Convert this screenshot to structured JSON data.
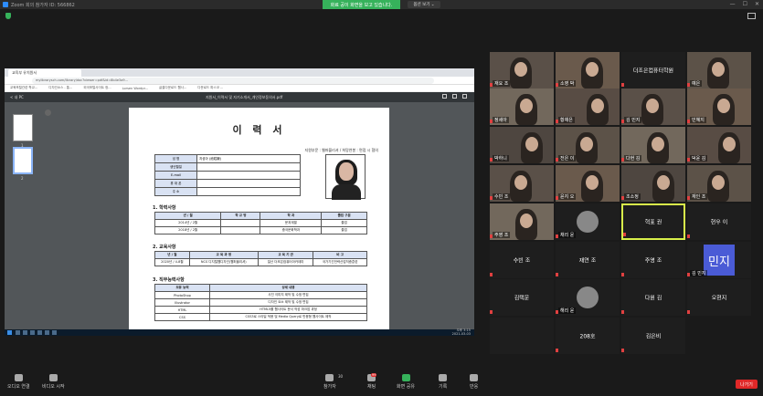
{
  "window": {
    "title": "Zoom 회의 참가자 ID: 566862",
    "share_banner": "화료 공이 화면을 보고 있습니다.",
    "view_options": "옵션 보기 ⌄",
    "controls": [
      "—",
      "☐",
      "✕"
    ]
  },
  "browser": {
    "tab_title": "교육부 유치원서",
    "url": "mylibrarysch.com/library/doc?viewer=pdf&id=8b4e3a9...",
    "bookmarks": [
      "교육포털관련 학교...",
      "디자인소스 - 통...",
      "외국포털사이트 정...",
      "Lorsen Wordpr...",
      "글꼴다운로드 웹사...",
      "다운로드 파스코 ..."
    ]
  },
  "pdf": {
    "back": "< 내 PC",
    "filename": "지원서_이력서 및 자기소개서_개인정보동의서.pdf",
    "thumb_nums": [
      "1",
      "2"
    ],
    "doc_title": "이 력 서",
    "apply_line": "지원부문 : 웹퍼블리셔  /  희망연봉 : 면접 시 협의",
    "info_rows": [
      {
        "k": "성 명",
        "v": "지성아 (池姓娥)"
      },
      {
        "k": "생년월일",
        "v": ""
      },
      {
        "k": "E-mail",
        "v": ""
      },
      {
        "k": "휴 대 폰",
        "v": ""
      },
      {
        "k": "주 소",
        "v": ""
      }
    ],
    "sec1": "1. 학력사항",
    "sec1_head": [
      "년 / 월",
      "학 교 명",
      "학 과",
      "졸업 구분"
    ],
    "sec1_rows": [
      [
        "2014년 / 2월",
        "",
        "문과계열",
        "졸업"
      ],
      [
        "2018년 / 2월",
        "",
        "중국문화학과",
        "졸업"
      ]
    ],
    "sec2": "2. 교육사항",
    "sec2_head": [
      "년 / 월",
      "교 육 과 정",
      "교 육 기 관",
      "비 고"
    ],
    "sec2_rows": [
      [
        "2020년 / 4-8월",
        "NCS 디지털웹디자인(웹퍼블리셔)",
        "일산 더조은컴퓨터아카데미",
        "국가기간전략산업직종훈련"
      ]
    ],
    "sec3": "3. 직무능력사항",
    "sec3_head": [
      "보유 능력",
      "상세 내용"
    ],
    "sec3_rows": [
      [
        "PhotoShop",
        "사진 이미지 제작 및 수정 편집"
      ],
      [
        "Illustrator",
        "디자인 요소 제작 및 수정 편집"
      ],
      [
        "HTML",
        "HTML5를 웹사이트 문서 작성 마크업 과정"
      ],
      [
        "CSS",
        "CSS3로 스타일 적용 및 Media Query로 반응형 웹사이트 제작"
      ]
    ],
    "clock": [
      "오후 3:15",
      "2021-03-03"
    ]
  },
  "gallery": [
    {
      "caption": "재요 조",
      "type": "video"
    },
    {
      "caption": "소영 박",
      "type": "video"
    },
    {
      "caption": "더조은컴퓨터학원",
      "type": "name"
    },
    {
      "caption": "예은",
      "type": "video"
    },
    {
      "caption": "정세아",
      "type": "video"
    },
    {
      "caption": "황채은",
      "type": "video"
    },
    {
      "caption": "김 민지",
      "type": "video"
    },
    {
      "caption": "민혜지",
      "type": "video"
    },
    {
      "caption": "박하니",
      "type": "video"
    },
    {
      "caption": "전은 이",
      "type": "video"
    },
    {
      "caption": "다현 김",
      "type": "video"
    },
    {
      "caption": "덕윤 김",
      "type": "video"
    },
    {
      "caption": "수빈 조",
      "type": "video"
    },
    {
      "caption": "윤지 오",
      "type": "video"
    },
    {
      "caption": "조소정",
      "type": "video"
    },
    {
      "caption": "재인 조",
      "type": "video"
    },
    {
      "caption": "주영 조",
      "type": "video"
    },
    {
      "caption": "채리 윤",
      "type": "avatar"
    },
    {
      "caption": "혁표 권",
      "type": "active"
    },
    {
      "caption": "현우 이",
      "type": "name"
    },
    {
      "caption": "수빈 조",
      "type": "name"
    },
    {
      "caption": "재연 조",
      "type": "name"
    },
    {
      "caption": "주영 조",
      "type": "name"
    },
    {
      "caption": "김 민지",
      "type": "minji",
      "initials": "민지"
    },
    {
      "caption": "김택운",
      "type": "name"
    },
    {
      "caption": "해리 윤",
      "type": "avatar"
    },
    {
      "caption": "다원 김",
      "type": "name"
    },
    {
      "caption": "오현지",
      "type": "name"
    },
    {
      "caption": "",
      "type": "empty"
    },
    {
      "caption": "208호",
      "type": "name"
    },
    {
      "caption": "김은비",
      "type": "name"
    }
  ],
  "toolbar": {
    "audio": "오디오 연결",
    "video": "비디오 시작",
    "participants": "참가자",
    "participants_count": "30",
    "chat": "채팅",
    "chat_badge": "99",
    "share": "화면 공유",
    "record": "기록",
    "reactions": "반응",
    "leave": "나가기"
  },
  "colors": {
    "accent_green": "#36b25b",
    "leave_red": "#e02828",
    "active_border": "#d9f04a",
    "minji_avatar": "#4a5bd6"
  }
}
